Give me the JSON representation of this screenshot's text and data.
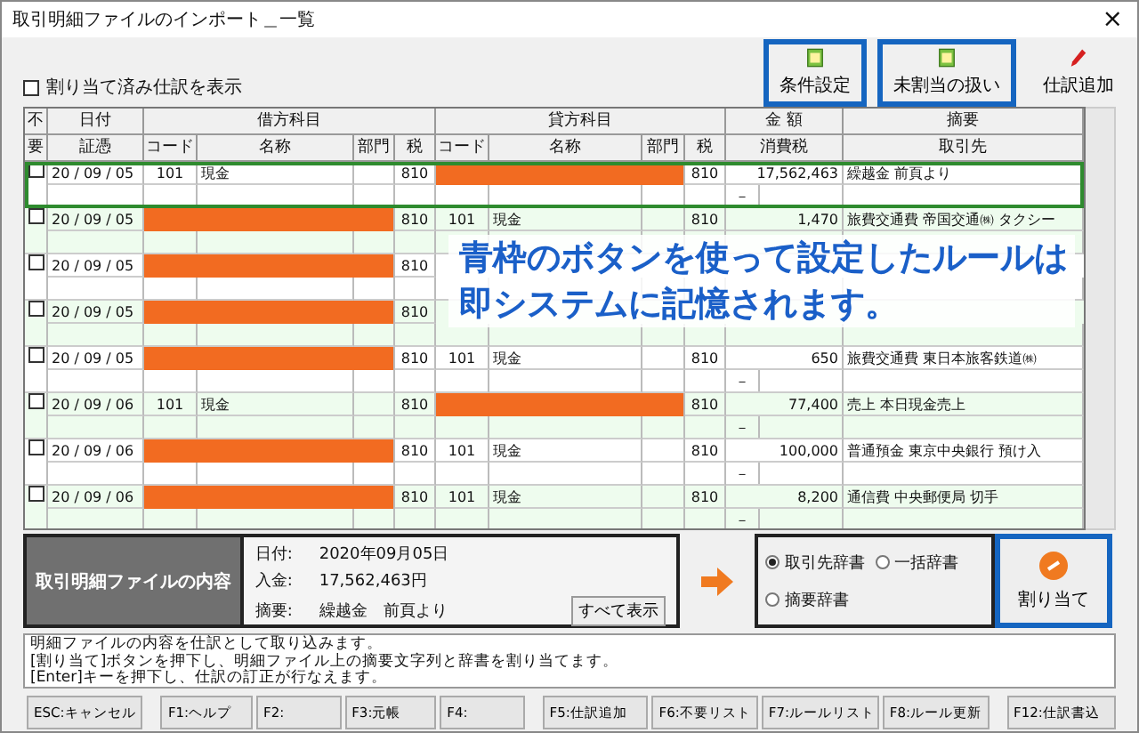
{
  "window": {
    "title": "取引明細ファイルのインポート＿一覧",
    "close": "×"
  },
  "toolbar": [
    {
      "label": "条件設定",
      "kind": "document",
      "highlighted": true
    },
    {
      "label": "未割当の扱い",
      "kind": "document",
      "highlighted": true
    },
    {
      "label": "仕訳追加",
      "kind": "pencil",
      "highlighted": false
    }
  ],
  "show_assigned": {
    "label": "割り当て済み仕訳を表示",
    "checked": false
  },
  "table": {
    "header_top": [
      "不",
      "日付",
      "借方科目",
      "貸方科目",
      "金 額",
      "摘要"
    ],
    "header_bottom": [
      "要",
      "証憑",
      "コード",
      "名称",
      "部門",
      "税",
      "コード",
      "名称",
      "部門",
      "税",
      "消費税",
      "取引先"
    ],
    "rows": [
      {
        "checked": false,
        "selected": true,
        "date": "20 / 09 / 05",
        "debit": {
          "kind": "account",
          "code": "101",
          "name": "現金"
        },
        "debit_tax": "810",
        "credit": {
          "kind": "unassigned"
        },
        "credit_tax": "810",
        "amount": "17,562,463",
        "summary": "繰越金 前頁より",
        "sub_mark": "－"
      },
      {
        "checked": false,
        "selected": false,
        "date": "20 / 09 / 05",
        "debit": {
          "kind": "unassigned"
        },
        "debit_tax": "810",
        "credit": {
          "kind": "account",
          "code": "101",
          "name": "現金"
        },
        "credit_tax": "810",
        "amount": "1,470",
        "summary": "旅費交通費 帝国交通㈱ タクシー"
      },
      {
        "checked": false,
        "selected": false,
        "date": "20 / 09 / 05",
        "debit": {
          "kind": "unassigned"
        },
        "debit_tax": "810"
      },
      {
        "checked": false,
        "selected": false,
        "date": "20 / 09 / 05",
        "debit": {
          "kind": "unassigned"
        },
        "debit_tax": "810"
      },
      {
        "checked": false,
        "selected": false,
        "date": "20 / 09 / 05",
        "debit": {
          "kind": "unassigned"
        },
        "debit_tax": "810",
        "credit": {
          "kind": "account",
          "code": "101",
          "name": "現金"
        },
        "credit_tax": "810",
        "amount": "650",
        "summary": "旅費交通費 東日本旅客鉄道㈱",
        "sub_mark": "－"
      },
      {
        "checked": false,
        "selected": false,
        "date": "20 / 09 / 06",
        "debit": {
          "kind": "account",
          "code": "101",
          "name": "現金"
        },
        "debit_tax": "810",
        "credit": {
          "kind": "unassigned"
        },
        "credit_tax": "810",
        "amount": "77,400",
        "summary": "売上 本日現金売上",
        "sub_mark": "－"
      },
      {
        "checked": false,
        "selected": false,
        "date": "20 / 09 / 06",
        "debit": {
          "kind": "unassigned"
        },
        "debit_tax": "810",
        "credit": {
          "kind": "account",
          "code": "101",
          "name": "現金"
        },
        "credit_tax": "810",
        "amount": "100,000",
        "summary": "普通預金 東京中央銀行 預け入",
        "sub_mark": "－"
      },
      {
        "checked": false,
        "selected": false,
        "date": "20 / 09 / 06",
        "debit": {
          "kind": "unassigned"
        },
        "debit_tax": "810",
        "credit": {
          "kind": "account",
          "code": "101",
          "name": "現金"
        },
        "credit_tax": "810",
        "amount": "8,200",
        "summary": "通信費 中央郵便局 切手",
        "sub_mark": "－"
      }
    ]
  },
  "caption": [
    "青枠のボタンを使って設定したルールは",
    "即システムに記憶されます。"
  ],
  "detail": {
    "title": "取引明細ファイルの内容",
    "fields": [
      {
        "label": "日付:",
        "value": "2020年09月05日"
      },
      {
        "label": "入金:",
        "value": "17,562,463円"
      },
      {
        "label": "摘要:",
        "value": "繰越金　前頁より"
      }
    ],
    "button": "すべて表示"
  },
  "dictionaries": [
    {
      "label": "取引先辞書",
      "selected": true
    },
    {
      "label": "一括辞書",
      "selected": false
    },
    {
      "label": "摘要辞書",
      "selected": false
    }
  ],
  "assign_button": {
    "label": "割り当て",
    "highlighted": true
  },
  "messages": [
    "明細ファイルの内容を仕訳として取り込みます。",
    "[割り当て]ボタンを押下し、明細ファイル上の摘要文字列と辞書を割り当てます。",
    "[Enter]キーを押下し、仕訳の訂正が行なえます。"
  ],
  "function_keys": [
    "ESC:キャンセル",
    "F1:ヘルプ",
    "F2:",
    "F3:元帳",
    "F4:",
    "F5:仕訳追加",
    "F6:不要リスト",
    "F7:ルールリスト",
    "F8:ルール更新",
    "F12:仕訳書込"
  ]
}
